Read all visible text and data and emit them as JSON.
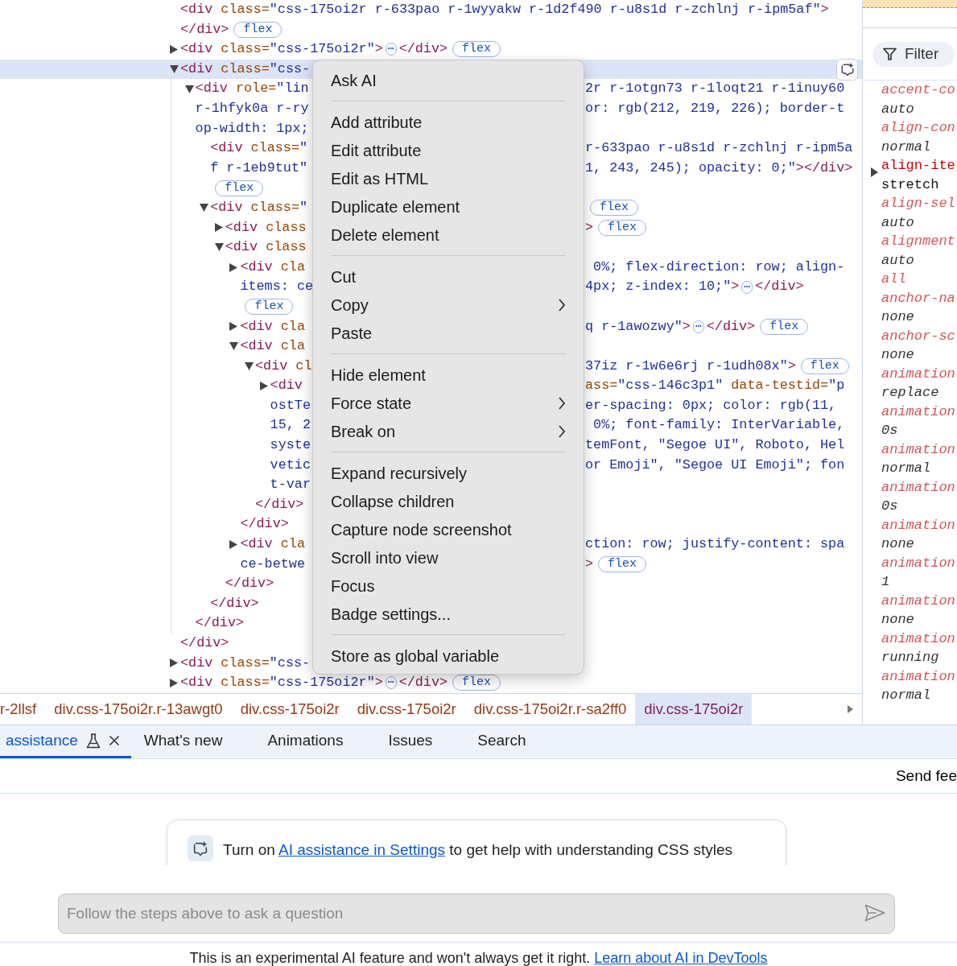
{
  "elements_tree": [
    {
      "kind": "leaf",
      "selected": false,
      "lines": [
        {
          "left": [
            {
              "kind": "tag",
              "text": "<div"
            },
            {
              "kind": "attr",
              "text": " class="
            },
            {
              "kind": "value",
              "text": "\"css-175oi2r r-633pao r-1wyyakw r-1d2f490 r-u8s1d r-zchlnj r-ipm5af\""
            },
            {
              "kind": "tag",
              "text": ">"
            }
          ]
        }
      ],
      "close": [
        {
          "kind": "tag",
          "text": "</div>"
        },
        {
          "kind": "badge",
          "text": "flex"
        }
      ]
    },
    {
      "kind": "parent",
      "expanded": false,
      "selected": false,
      "lines": [
        {
          "left": [
            {
              "kind": "tag",
              "text": "<div"
            },
            {
              "kind": "attr",
              "text": " class="
            },
            {
              "kind": "value",
              "text": "\"css-175oi2r\""
            },
            {
              "kind": "tag",
              "text": ">"
            },
            {
              "kind": "ellipsis",
              "text": "⋯"
            },
            {
              "kind": "tag",
              "text": "</div>"
            },
            {
              "kind": "badge",
              "text": "flex"
            }
          ]
        }
      ]
    },
    {
      "kind": "parent",
      "expanded": true,
      "selected": true,
      "lines": [
        {
          "left": [
            {
              "kind": "tag",
              "text": "<div"
            },
            {
              "kind": "attr",
              "text": " class="
            },
            {
              "kind": "value",
              "text": "\"css-"
            }
          ]
        }
      ],
      "close": [
        {
          "kind": "tag",
          "text": "</div>"
        }
      ],
      "children": [
        {
          "kind": "parent",
          "expanded": true,
          "selected": false,
          "lines": [
            {
              "left": [
                {
                  "kind": "tag",
                  "text": "<div"
                },
                {
                  "kind": "attr",
                  "text": " role="
                },
                {
                  "kind": "value",
                  "text": "\"lin"
                }
              ],
              "right": [
                {
                  "kind": "value",
                  "text": "2r r-1otgn73 r-1loqt21 r-1inuy60"
                }
              ]
            },
            {
              "left": [
                {
                  "kind": "value",
                  "text": "r-1hfyk0a r-ry"
                }
              ],
              "right": [
                {
                  "kind": "value",
                  "text": "or: rgb(212, 219, 226); border-t"
                }
              ]
            },
            {
              "left": [
                {
                  "kind": "value",
                  "text": "op-width: 1px;"
                }
              ]
            }
          ],
          "close": [
            {
              "kind": "tag",
              "text": "</div>"
            }
          ],
          "children": [
            {
              "kind": "leaf",
              "selected": false,
              "lines": [
                {
                  "left": [
                    {
                      "kind": "tag",
                      "text": "<div"
                    },
                    {
                      "kind": "attr",
                      "text": " class="
                    },
                    {
                      "kind": "value",
                      "text": "\""
                    }
                  ],
                  "right": [
                    {
                      "kind": "value",
                      "text": "r-633pao r-u8s1d r-zchlnj r-ipm5a"
                    }
                  ]
                },
                {
                  "left": [
                    {
                      "kind": "value",
                      "text": "f r-1eb9tut\""
                    }
                  ],
                  "right": [
                    {
                      "kind": "value",
                      "text": "1, 243, 245); opacity: 0;\""
                    },
                    {
                      "kind": "tag",
                      "text": "></div>"
                    }
                  ]
                },
                {
                  "left": [
                    {
                      "kind": "badge",
                      "text": "flex"
                    }
                  ]
                }
              ]
            },
            {
              "kind": "parent",
              "expanded": true,
              "selected": false,
              "lines": [
                {
                  "left": [
                    {
                      "kind": "tag",
                      "text": "<div"
                    },
                    {
                      "kind": "attr",
                      "text": " class="
                    },
                    {
                      "kind": "value",
                      "text": "\""
                    }
                  ],
                  "right": [
                    {
                      "kind": "badge",
                      "text": "flex"
                    }
                  ]
                }
              ],
              "close": [
                {
                  "kind": "tag",
                  "text": "</div>"
                }
              ],
              "children": [
                {
                  "kind": "parent",
                  "expanded": false,
                  "selected": false,
                  "lines": [
                    {
                      "left": [
                        {
                          "kind": "tag",
                          "text": "<div"
                        },
                        {
                          "kind": "attr",
                          "text": " class"
                        }
                      ],
                      "right": [
                        {
                          "kind": "tag",
                          "text": ">"
                        },
                        {
                          "kind": "badge",
                          "text": "flex"
                        }
                      ]
                    }
                  ]
                },
                {
                  "kind": "parent",
                  "expanded": true,
                  "selected": false,
                  "lines": [
                    {
                      "left": [
                        {
                          "kind": "tag",
                          "text": "<div"
                        },
                        {
                          "kind": "attr",
                          "text": " class"
                        }
                      ]
                    }
                  ],
                  "close": [
                    {
                      "kind": "tag",
                      "text": "</div>"
                    }
                  ],
                  "children": [
                    {
                      "kind": "parent",
                      "expanded": false,
                      "selected": false,
                      "lines": [
                        {
                          "left": [
                            {
                              "kind": "tag",
                              "text": "<div"
                            },
                            {
                              "kind": "attr",
                              "text": " cla"
                            }
                          ],
                          "right": [
                            {
                              "kind": "value",
                              "text": " 0%; flex-direction: row; align-"
                            }
                          ]
                        },
                        {
                          "left": [
                            {
                              "kind": "value",
                              "text": "items: ce"
                            }
                          ],
                          "right": [
                            {
                              "kind": "value",
                              "text": "4px; z-index: 10;\""
                            },
                            {
                              "kind": "tag",
                              "text": ">"
                            },
                            {
                              "kind": "ellipsis",
                              "text": "⋯"
                            },
                            {
                              "kind": "tag",
                              "text": "</div>"
                            }
                          ]
                        },
                        {
                          "left": [
                            {
                              "kind": "badge",
                              "text": "flex"
                            }
                          ]
                        }
                      ]
                    },
                    {
                      "kind": "parent",
                      "expanded": false,
                      "selected": false,
                      "lines": [
                        {
                          "left": [
                            {
                              "kind": "tag",
                              "text": "<div"
                            },
                            {
                              "kind": "attr",
                              "text": " cla"
                            }
                          ],
                          "right": [
                            {
                              "kind": "value",
                              "text": "q r-1awozwy\""
                            },
                            {
                              "kind": "tag",
                              "text": ">"
                            },
                            {
                              "kind": "ellipsis",
                              "text": "⋯"
                            },
                            {
                              "kind": "tag",
                              "text": "</div>"
                            },
                            {
                              "kind": "badge",
                              "text": "flex"
                            }
                          ]
                        }
                      ]
                    },
                    {
                      "kind": "parent",
                      "expanded": true,
                      "selected": false,
                      "lines": [
                        {
                          "left": [
                            {
                              "kind": "tag",
                              "text": "<div"
                            },
                            {
                              "kind": "attr",
                              "text": " cla"
                            }
                          ]
                        }
                      ],
                      "close": [
                        {
                          "kind": "tag",
                          "text": "</div>"
                        }
                      ],
                      "children": [
                        {
                          "kind": "parent",
                          "expanded": true,
                          "selected": false,
                          "lines": [
                            {
                              "left": [
                                {
                                  "kind": "tag",
                                  "text": "<div"
                                },
                                {
                                  "kind": "attr",
                                  "text": " cl"
                                }
                              ],
                              "right": [
                                {
                                  "kind": "value",
                                  "text": "37iz r-1w6e6rj r-1udh08x\""
                                },
                                {
                                  "kind": "tag",
                                  "text": ">"
                                },
                                {
                                  "kind": "badge",
                                  "text": "flex"
                                }
                              ]
                            }
                          ],
                          "close": [
                            {
                              "kind": "tag",
                              "text": "</div>"
                            }
                          ],
                          "children": [
                            {
                              "kind": "parent",
                              "expanded": false,
                              "selected": false,
                              "lines": [
                                {
                                  "left": [
                                    {
                                      "kind": "tag",
                                      "text": "<div"
                                    }
                                  ],
                                  "right": [
                                    {
                                      "kind": "attr",
                                      "text": "ass="
                                    },
                                    {
                                      "kind": "value",
                                      "text": "\"css-146c3p1\""
                                    },
                                    {
                                      "kind": "attr",
                                      "text": " data-testid="
                                    },
                                    {
                                      "kind": "value",
                                      "text": "\"p"
                                    }
                                  ]
                                },
                                {
                                  "left": [
                                    {
                                      "kind": "value",
                                      "text": "ostTe"
                                    }
                                  ],
                                  "right": [
                                    {
                                      "kind": "value",
                                      "text": "er-spacing: 0px; color: rgb(11,"
                                    }
                                  ]
                                },
                                {
                                  "left": [
                                    {
                                      "kind": "value",
                                      "text": "15, 2"
                                    }
                                  ],
                                  "right": [
                                    {
                                      "kind": "value",
                                      "text": " 0%; font-family: InterVariable,"
                                    }
                                  ]
                                },
                                {
                                  "left": [
                                    {
                                      "kind": "value",
                                      "text": "syste"
                                    }
                                  ],
                                  "right": [
                                    {
                                      "kind": "value",
                                      "text": "temFont, \"Segoe UI\", Roboto, Hel"
                                    }
                                  ]
                                },
                                {
                                  "left": [
                                    {
                                      "kind": "value",
                                      "text": "vetic"
                                    }
                                  ],
                                  "right": [
                                    {
                                      "kind": "value",
                                      "text": "or Emoji\", \"Segoe UI Emoji\"; fon"
                                    }
                                  ]
                                },
                                {
                                  "left": [
                                    {
                                      "kind": "value",
                                      "text": "t-var"
                                    }
                                  ]
                                }
                              ]
                            }
                          ]
                        }
                      ]
                    },
                    {
                      "kind": "parent",
                      "expanded": false,
                      "selected": false,
                      "lines": [
                        {
                          "left": [
                            {
                              "kind": "tag",
                              "text": "<div"
                            },
                            {
                              "kind": "attr",
                              "text": " cla"
                            }
                          ],
                          "right": [
                            {
                              "kind": "value",
                              "text": "ction: row; justify-content: spa"
                            }
                          ]
                        },
                        {
                          "left": [
                            {
                              "kind": "value",
                              "text": "ce-betwe"
                            }
                          ],
                          "right": [
                            {
                              "kind": "tag",
                              "text": ">"
                            },
                            {
                              "kind": "badge",
                              "text": "flex"
                            }
                          ]
                        }
                      ]
                    }
                  ]
                }
              ]
            }
          ]
        }
      ]
    },
    {
      "kind": "parent",
      "expanded": false,
      "selected": false,
      "lines": [
        {
          "left": [
            {
              "kind": "tag",
              "text": "<div"
            },
            {
              "kind": "attr",
              "text": " class="
            },
            {
              "kind": "value",
              "text": "\"css-"
            }
          ]
        }
      ]
    },
    {
      "kind": "parent",
      "expanded": false,
      "selected": false,
      "lines": [
        {
          "left": [
            {
              "kind": "tag",
              "text": "<div"
            },
            {
              "kind": "attr",
              "text": " class="
            },
            {
              "kind": "value",
              "text": "\"css-175oi2r\""
            },
            {
              "kind": "tag",
              "text": ">"
            },
            {
              "kind": "ellipsis",
              "text": "⋯"
            },
            {
              "kind": "tag",
              "text": "</div>"
            },
            {
              "kind": "badge",
              "text": "flex"
            }
          ]
        }
      ]
    }
  ],
  "context_menu": {
    "groups": [
      {
        "items": [
          {
            "label": "Ask AI",
            "submenu": false
          }
        ]
      },
      {
        "items": [
          {
            "label": "Add attribute",
            "submenu": false
          },
          {
            "label": "Edit attribute",
            "submenu": false
          },
          {
            "label": "Edit as HTML",
            "submenu": false
          },
          {
            "label": "Duplicate element",
            "submenu": false
          },
          {
            "label": "Delete element",
            "submenu": false
          }
        ]
      },
      {
        "items": [
          {
            "label": "Cut",
            "submenu": false
          },
          {
            "label": "Copy",
            "submenu": true
          },
          {
            "label": "Paste",
            "submenu": false
          }
        ]
      },
      {
        "items": [
          {
            "label": "Hide element",
            "submenu": false
          },
          {
            "label": "Force state",
            "submenu": true
          },
          {
            "label": "Break on",
            "submenu": true
          }
        ]
      },
      {
        "items": [
          {
            "label": "Expand recursively",
            "submenu": false
          },
          {
            "label": "Collapse children",
            "submenu": false
          },
          {
            "label": "Capture node screenshot",
            "submenu": false
          },
          {
            "label": "Scroll into view",
            "submenu": false
          },
          {
            "label": "Focus",
            "submenu": false
          },
          {
            "label": "Badge settings...",
            "submenu": false
          }
        ]
      },
      {
        "items": [
          {
            "label": "Store as global variable",
            "submenu": false
          }
        ]
      }
    ]
  },
  "breadcrumbs": [
    {
      "label": "r-2llsf",
      "selected": false
    },
    {
      "label": "div.css-175oi2r.r-13awgt0",
      "selected": false
    },
    {
      "label": "div.css-175oi2r",
      "selected": false
    },
    {
      "label": "div.css-175oi2r",
      "selected": false
    },
    {
      "label": "div.css-175oi2r.r-sa2ff0",
      "selected": false
    },
    {
      "label": "div.css-175oi2r",
      "selected": true
    }
  ],
  "styles_pane": {
    "filter": {
      "placeholder": "Filter"
    },
    "properties": [
      {
        "name": "accent-co",
        "value": "auto",
        "is_default": true,
        "expandable": false
      },
      {
        "name": "align-con",
        "value": "normal",
        "is_default": true,
        "expandable": false
      },
      {
        "name": "align-ite",
        "value": "stretch",
        "is_default": false,
        "expandable": true
      },
      {
        "name": "align-sel",
        "value": "auto",
        "is_default": true,
        "expandable": false
      },
      {
        "name": "alignment",
        "value": "auto",
        "is_default": true,
        "expandable": false
      },
      {
        "name": "all",
        "is_default": true,
        "expandable": false
      },
      {
        "name": "anchor-na",
        "value": "none",
        "is_default": true,
        "expandable": false
      },
      {
        "name": "anchor-sc",
        "value": "none",
        "is_default": true,
        "expandable": false
      },
      {
        "name": "animation",
        "value": "replace",
        "is_default": true,
        "expandable": false
      },
      {
        "name": "animation",
        "value": "0s",
        "is_default": true,
        "expandable": false
      },
      {
        "name": "animation",
        "value": "normal",
        "is_default": true,
        "expandable": false
      },
      {
        "name": "animation",
        "value": "0s",
        "is_default": true,
        "expandable": false
      },
      {
        "name": "animation",
        "value": "none",
        "is_default": true,
        "expandable": false
      },
      {
        "name": "animation",
        "value": "1",
        "is_default": true,
        "expandable": false
      },
      {
        "name": "animation",
        "value": "none",
        "is_default": true,
        "expandable": false
      },
      {
        "name": "animation",
        "value": "running",
        "is_default": true,
        "expandable": false
      },
      {
        "name": "animation",
        "value": "normal",
        "is_default": true,
        "expandable": false
      }
    ]
  },
  "drawer": {
    "tabs": [
      {
        "label": "assistance",
        "selected": true,
        "experimental": true,
        "closable": true
      },
      {
        "label": "What's new",
        "selected": false,
        "experimental": false,
        "closable": false
      },
      {
        "label": "Animations",
        "selected": false,
        "experimental": false,
        "closable": false
      },
      {
        "label": "Issues",
        "selected": false,
        "experimental": false,
        "closable": false
      },
      {
        "label": "Search",
        "selected": false,
        "experimental": false,
        "closable": false
      }
    ],
    "toolbar": {
      "button": "Send fee"
    },
    "notice": {
      "before": "Turn on ",
      "link": "AI assistance in Settings",
      "after": " to get help with understanding CSS styles"
    },
    "prompt": {
      "placeholder": "Follow the steps above to ask a question",
      "disabled": true
    },
    "disclaimer": {
      "text": "This is an experimental AI feature and won't always get it right. ",
      "link": "Learn about AI in DevTools"
    }
  }
}
